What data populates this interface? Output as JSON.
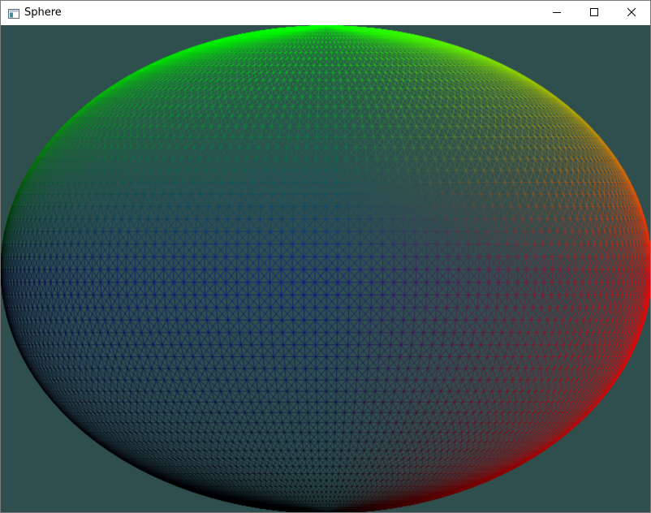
{
  "window": {
    "title": "Sphere",
    "icon": "app-window-icon",
    "controls": [
      "minimize-icon",
      "maximize-icon",
      "close-icon"
    ]
  },
  "viewport": {
    "background_color": "#2f4f4f",
    "render": "wireframe-sphere",
    "colors": {
      "top": "#00ff00",
      "right": "#ff0000",
      "center": "#0000ff",
      "left_bottom": "#000000"
    }
  }
}
